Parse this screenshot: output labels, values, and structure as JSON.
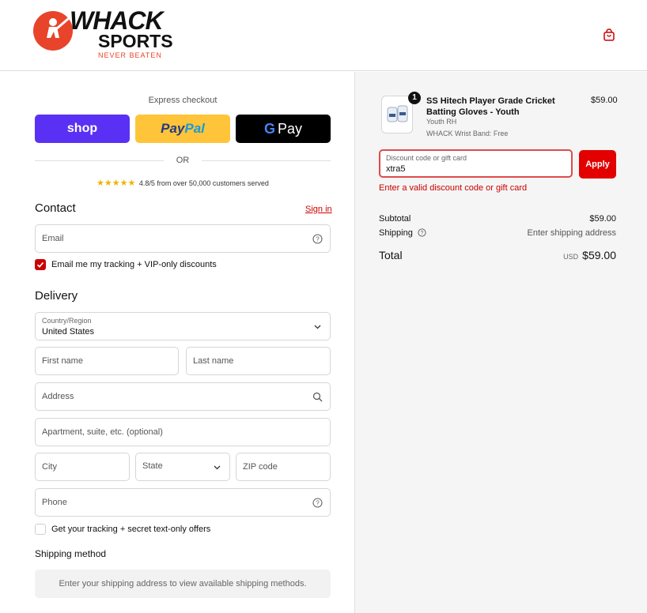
{
  "brand": {
    "line1": "WHACK",
    "line2": "SPORTS",
    "tagline": "NEVER BEATEN",
    "accent": "#e8442b"
  },
  "header": {
    "cart_icon": "shopping-bag-icon"
  },
  "express": {
    "title": "Express checkout",
    "shop_label": "shop",
    "paypal_part1": "Pay",
    "paypal_part2": "Pal",
    "gpay_g": "G",
    "gpay_label": "Pay",
    "or_label": "OR",
    "stars": "★★★★★",
    "rating_text": "4.8/5 from over 50,000 customers served"
  },
  "contact": {
    "title": "Contact",
    "signin_label": "Sign in",
    "email_placeholder": "Email",
    "email_optin_label": "Email me my tracking + VIP-only discounts",
    "email_optin_checked": true
  },
  "delivery": {
    "title": "Delivery",
    "country_label": "Country/Region",
    "country_value": "United States",
    "first_name_placeholder": "First name",
    "last_name_placeholder": "Last name",
    "address_placeholder": "Address",
    "apartment_placeholder": "Apartment, suite, etc. (optional)",
    "city_placeholder": "City",
    "state_placeholder": "State",
    "zip_placeholder": "ZIP code",
    "phone_placeholder": "Phone",
    "sms_optin_label": "Get your tracking + secret text-only offers",
    "sms_optin_checked": false
  },
  "shipping_method": {
    "title": "Shipping method",
    "note": "Enter your shipping address to view available shipping methods."
  },
  "order": {
    "quantity": "1",
    "product_name": "SS Hitech Player Grade Cricket Batting Gloves - Youth",
    "variant": "Youth RH",
    "addon": "WHACK Wrist Band: Free",
    "price": "$59.00",
    "discount_label": "Discount code or gift card",
    "discount_value": "xtra5",
    "apply_label": "Apply",
    "error": "Enter a valid discount code or gift card",
    "subtotal_label": "Subtotal",
    "subtotal_value": "$59.00",
    "shipping_label": "Shipping",
    "shipping_value": "Enter shipping address",
    "total_label": "Total",
    "currency": "USD",
    "total_value": "$59.00",
    "accent": "#e30000"
  }
}
